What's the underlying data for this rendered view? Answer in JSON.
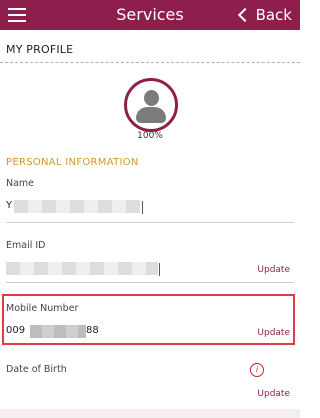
{
  "header": {
    "title": "Services",
    "back_label": "Back"
  },
  "page": {
    "my_profile": "MY PROFILE",
    "completion": "100%",
    "section_title": "PERSONAL INFORMATION"
  },
  "fields": {
    "name": {
      "label": "Name",
      "value_prefix": "Y"
    },
    "email": {
      "label": "Email ID",
      "update_label": "Update"
    },
    "mobile": {
      "label": "Mobile Number",
      "value_prefix": "009",
      "value_suffix": "88",
      "update_label": "Update"
    },
    "dob": {
      "label": "Date of Birth",
      "update_label": "Update",
      "info_glyph": "i"
    }
  },
  "colors": {
    "brand": "#8e1f4d",
    "section_title": "#d19825",
    "highlight": "#e23b47"
  },
  "icons": {
    "menu": "menu-icon",
    "back": "chevron-left-icon",
    "avatar": "user-avatar-icon",
    "info": "info-icon"
  }
}
